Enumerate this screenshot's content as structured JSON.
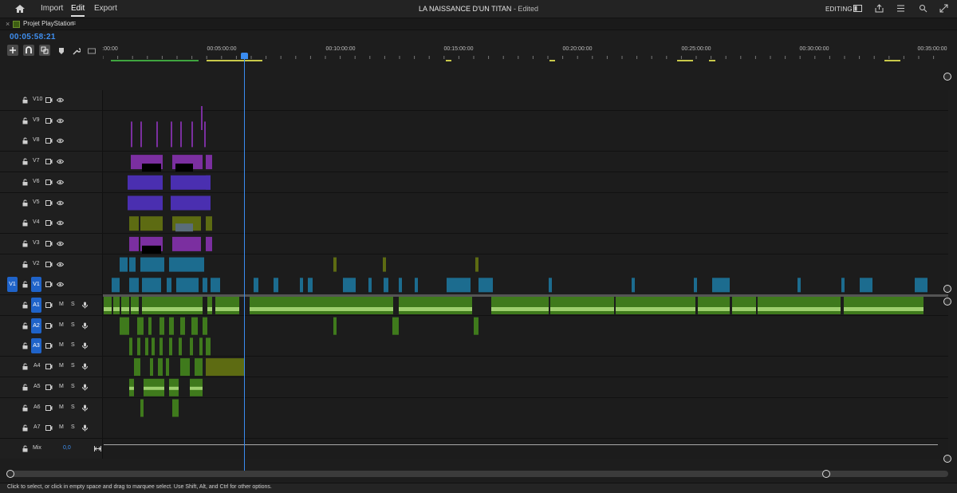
{
  "menu": {
    "home_icon": "home-icon",
    "import_label": "Import",
    "edit_label": "Edit",
    "export_label": "Export"
  },
  "title": {
    "project": "LA NAISSANCE D'UN TITAN",
    "suffix": " - Edited"
  },
  "workspace": {
    "label": "EDITING",
    "icons": [
      "panel-icon",
      "share-icon",
      "list-icon",
      "search-icon",
      "fullscreen-icon"
    ]
  },
  "panel": {
    "close": "×",
    "name": "Projet PlayStation",
    "menu": "≡",
    "color": "#3d5e12"
  },
  "timecode": "00:05:58:21",
  "tools": [
    "insert-overwrite-icon",
    "snap-icon",
    "linked-selection-icon",
    "marker-icon",
    "wrench-icon",
    "captions-icon"
  ],
  "ruler": {
    "labels": [
      ":00:00",
      "00:05:00:00",
      "00:10:00:00",
      "00:15:00:00",
      "00:20:00:00",
      "00:25:00:00",
      "00:30:00:00",
      "00:35:00:00"
    ]
  },
  "video_tracks": [
    {
      "label": "V10"
    },
    {
      "label": "V9"
    },
    {
      "label": "V8"
    },
    {
      "label": "V7"
    },
    {
      "label": "V6"
    },
    {
      "label": "V5"
    },
    {
      "label": "V4"
    },
    {
      "label": "V3"
    },
    {
      "label": "V2"
    },
    {
      "label": "V1",
      "source": "V1"
    }
  ],
  "audio_tracks": [
    {
      "label": "A1",
      "selected": true
    },
    {
      "label": "A2",
      "selected": true
    },
    {
      "label": "A3",
      "selected": true
    },
    {
      "label": "A4"
    },
    {
      "label": "A5"
    },
    {
      "label": "A6"
    },
    {
      "label": "A7"
    }
  ],
  "mix": {
    "label": "Mix",
    "value": "0,0"
  },
  "track_buttons": {
    "mute": "M",
    "solo": "S"
  },
  "status": "Click to select, or click in empty space and drag to marquee select. Use Shift, Alt, and Ctrl for other options.",
  "colors": {
    "accent": "#3a8cf0",
    "video_clip": "#1c6c8f",
    "purple_clip": "#7b2fa0",
    "violet_clip": "#4a2fb0",
    "olive_clip": "#5d6b12",
    "audio_clip": "#3f7a1c",
    "audio_wave": "#9dcf6e"
  }
}
